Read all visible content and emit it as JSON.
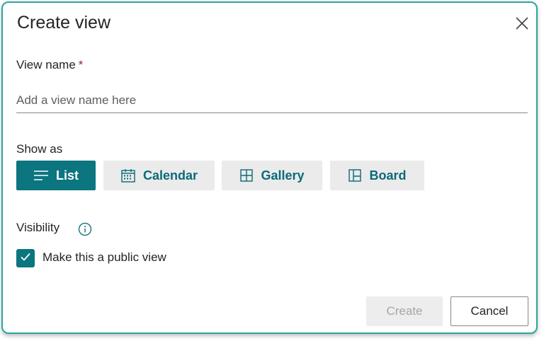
{
  "dialog": {
    "title": "Create view",
    "close_icon": "close-icon"
  },
  "view_name": {
    "label": "View name",
    "required_marker": "*",
    "placeholder": "Add a view name here",
    "value": ""
  },
  "show_as": {
    "label": "Show as",
    "options": [
      {
        "label": "List",
        "icon": "list-icon",
        "selected": true
      },
      {
        "label": "Calendar",
        "icon": "calendar-icon",
        "selected": false
      },
      {
        "label": "Gallery",
        "icon": "gallery-icon",
        "selected": false
      },
      {
        "label": "Board",
        "icon": "board-icon",
        "selected": false
      }
    ]
  },
  "visibility": {
    "label": "Visibility",
    "info_icon": "info-icon",
    "public_checkbox_label": "Make this a public view",
    "public_checked": true
  },
  "footer": {
    "create_label": "Create",
    "create_disabled": true,
    "cancel_label": "Cancel"
  },
  "colors": {
    "accent": "#0b7580",
    "accent_text": "#0b6a79",
    "border": "#2aa79b",
    "required": "#a4262c"
  }
}
